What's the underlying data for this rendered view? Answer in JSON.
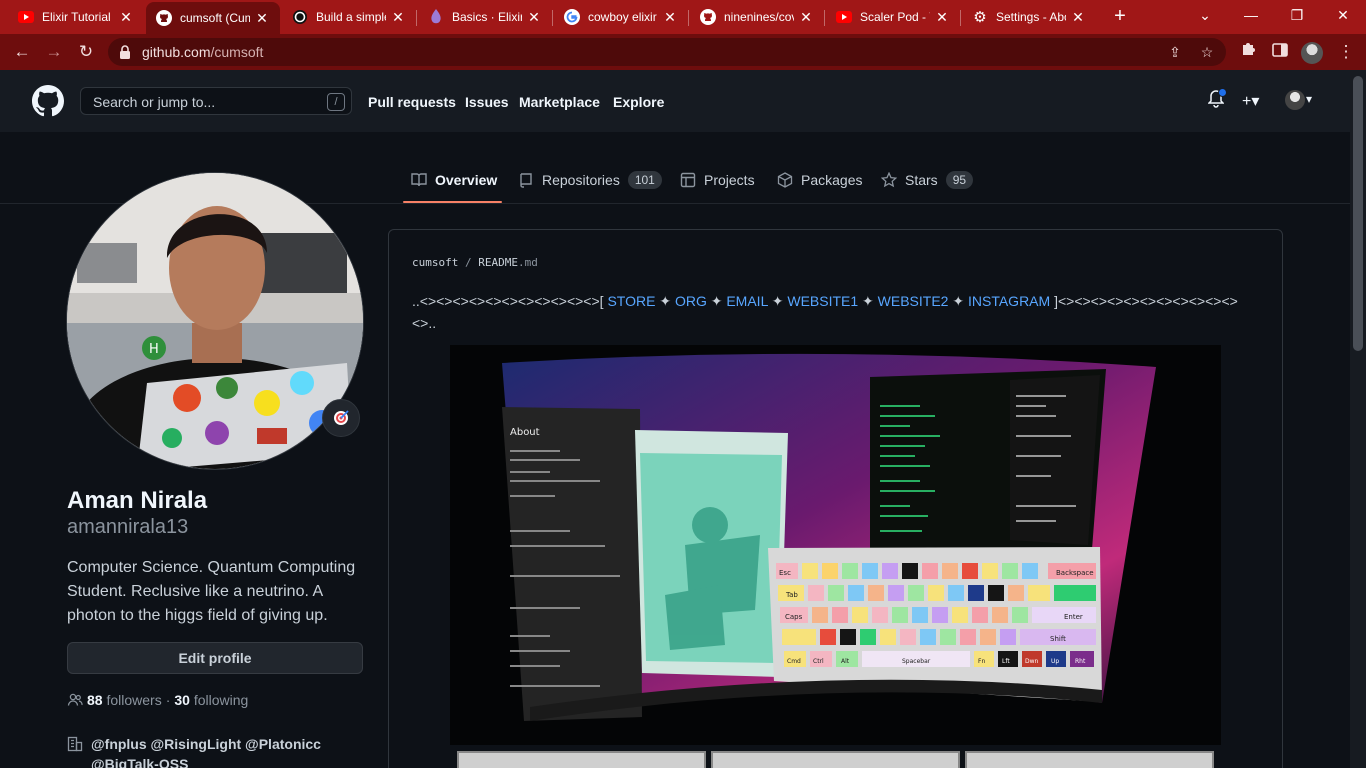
{
  "browser": {
    "tabs": [
      {
        "title": "Elixir Tutorial",
        "icon": "youtube-icon",
        "active": false
      },
      {
        "title": "cumsoft (Cum",
        "icon": "github-icon",
        "active": true
      },
      {
        "title": "Build a simple",
        "icon": "circle-icon",
        "active": false
      },
      {
        "title": "Basics · Elixir S",
        "icon": "elixir-icon",
        "active": false
      },
      {
        "title": "cowboy elixir",
        "icon": "google-icon",
        "active": false
      },
      {
        "title": "ninenines/cov",
        "icon": "github-icon",
        "active": false
      },
      {
        "title": "Scaler Pod - Y",
        "icon": "youtube-icon",
        "active": false
      },
      {
        "title": "Settings - Abo",
        "icon": "gear-icon",
        "active": false
      }
    ],
    "url_host": "github.com",
    "url_path": "/cumsoft",
    "theme_color": "#a01717"
  },
  "github": {
    "search_placeholder": "Search or jump to...",
    "search_shortcut": "/",
    "nav": [
      "Pull requests",
      "Issues",
      "Marketplace",
      "Explore"
    ]
  },
  "profile_nav": {
    "overview": "Overview",
    "repositories": "Repositories",
    "repositories_count": "101",
    "projects": "Projects",
    "packages": "Packages",
    "stars": "Stars",
    "stars_count": "95"
  },
  "profile": {
    "name": "Aman Nirala",
    "login": "amannirala13",
    "bio": "Computer Science. Quantum Computing Student. Reclusive like a neutrino. A photon to the higgs field of giving up.",
    "edit_button": "Edit profile",
    "followers_count": "88",
    "followers_label": "followers",
    "separator": "·",
    "following_count": "30",
    "following_label": "following",
    "orgs_line1": "@fnplus @RisingLight @Platonicc",
    "orgs_line2": "@BigTalk-OSS"
  },
  "readme": {
    "owner": "cumsoft",
    "path_sep": "/",
    "file": "README",
    "ext": ".md",
    "prefix": "..<><><><><><><><><><><>[",
    "links": [
      "STORE",
      "ORG",
      "EMAIL",
      "WEBSITE1",
      "WEBSITE2",
      "INSTAGRAM"
    ],
    "link_sep": "✦",
    "suffix": "]<><><><><><><><><><><>",
    "line2": "<>..",
    "link_color": "#58a6ff"
  },
  "screenshot_window": {
    "about_title": "About",
    "keys_row1": [
      "Esc",
      "Backspace"
    ],
    "keys_row2": [
      "Tab"
    ],
    "keys_row3": [
      "Caps",
      "Enter"
    ],
    "keys_row4": [
      "Shift"
    ],
    "keys_row5": [
      "Cmd",
      "Ctrl",
      "Alt",
      "Spacebar",
      "Fn",
      "Lft",
      "Dwn",
      "Up",
      "Rht"
    ]
  }
}
